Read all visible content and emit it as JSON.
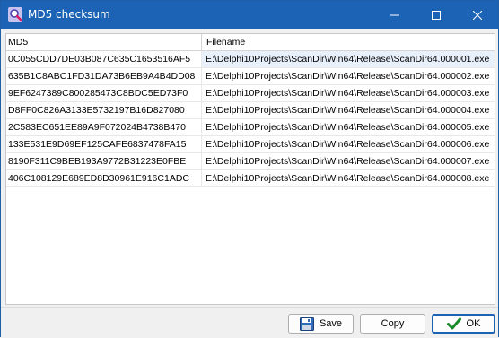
{
  "window": {
    "title": "MD5 checksum",
    "icon": "search-app-icon"
  },
  "grid": {
    "columns": [
      "MD5",
      "Filename"
    ],
    "rows": [
      {
        "md5": "0C055CDD7DE03B087C635C1653516AF5",
        "filename": "E:\\Delphi10Projects\\ScanDir\\Win64\\Release\\ScanDir64.000001.exe"
      },
      {
        "md5": "635B1C8ABC1FD31DA73B6EB9A4B4DD08",
        "filename": "E:\\Delphi10Projects\\ScanDir\\Win64\\Release\\ScanDir64.000002.exe"
      },
      {
        "md5": "9EF6247389C800285473C8BDC5ED73F0",
        "filename": "E:\\Delphi10Projects\\ScanDir\\Win64\\Release\\ScanDir64.000003.exe"
      },
      {
        "md5": "D8FF0C826A3133E5732197B16D827080",
        "filename": "E:\\Delphi10Projects\\ScanDir\\Win64\\Release\\ScanDir64.000004.exe"
      },
      {
        "md5": "2C583EC651EE89A9F072024B4738B470",
        "filename": "E:\\Delphi10Projects\\ScanDir\\Win64\\Release\\ScanDir64.000005.exe"
      },
      {
        "md5": "133E531E9D69EF125CAFE6837478FA15",
        "filename": "E:\\Delphi10Projects\\ScanDir\\Win64\\Release\\ScanDir64.000006.exe"
      },
      {
        "md5": "8190F311C9BEB193A9772B31223E0FBE",
        "filename": "E:\\Delphi10Projects\\ScanDir\\Win64\\Release\\ScanDir64.000007.exe"
      },
      {
        "md5": "406C108129E689ED8D30961E916C1ADC",
        "filename": "E:\\Delphi10Projects\\ScanDir\\Win64\\Release\\ScanDir64.000008.exe"
      }
    ]
  },
  "buttons": {
    "save": "Save",
    "copy": "Copy",
    "ok": "OK"
  },
  "colors": {
    "titlebar": "#1d63b5",
    "selected_row": "#e8f1fb",
    "ok_check": "#1a8a2a"
  }
}
